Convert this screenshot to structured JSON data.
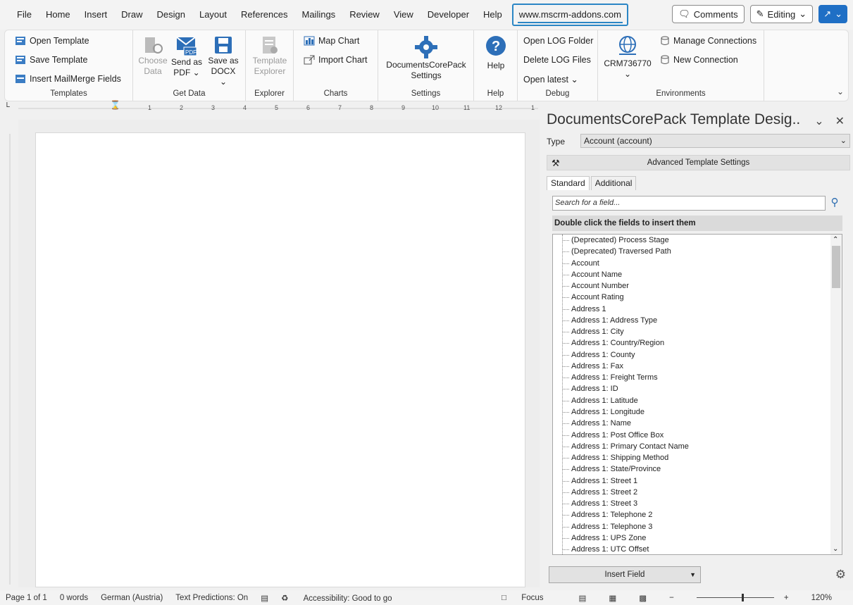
{
  "menubar": {
    "items": [
      "File",
      "Home",
      "Insert",
      "Draw",
      "Design",
      "Layout",
      "References",
      "Mailings",
      "Review",
      "View",
      "Developer",
      "Help"
    ],
    "active_tab": "www.mscrm-addons.com",
    "comments_label": "Comments",
    "editing_label": "Editing"
  },
  "ribbon": {
    "templates": {
      "open": "Open Template",
      "save": "Save Template",
      "insert_mailmerge": "Insert MailMerge Fields",
      "label": "Templates"
    },
    "get_data": {
      "choose_line1": "Choose",
      "choose_line2": "Data",
      "send_line1": "Send as",
      "send_line2": "PDF ⌄",
      "save_line1": "Save as",
      "save_line2": "DOCX ⌄",
      "label": "Get Data"
    },
    "explorer": {
      "btn_line1": "Template",
      "btn_line2": "Explorer",
      "label": "Explorer"
    },
    "charts": {
      "map_chart": "Map Chart",
      "import_chart": "Import Chart",
      "label": "Charts"
    },
    "settings": {
      "btn_line1": "DocumentsCorePack",
      "btn_line2": "Settings",
      "label": "Settings"
    },
    "help": {
      "btn": "Help",
      "label": "Help"
    },
    "debug": {
      "open_log": "Open LOG Folder",
      "delete_log": "Delete LOG Files",
      "open_latest": "Open latest ⌄",
      "label": "Debug"
    },
    "environments": {
      "crm": "CRM736770",
      "manage": "Manage Connections",
      "new_conn": "New Connection",
      "label": "Environments"
    }
  },
  "pane": {
    "title": "DocumentsCorePack Template Desig...",
    "type_label": "Type",
    "type_value": "Account (account)",
    "advanced_settings": "Advanced Template Settings",
    "tab_standard": "Standard",
    "tab_additional": "Additional",
    "search_placeholder": "Search for a field...",
    "list_header": "Double click the fields to insert them",
    "fields": [
      "(Deprecated) Process Stage",
      "(Deprecated) Traversed Path",
      "Account",
      "Account Name",
      "Account Number",
      "Account Rating",
      "Address 1",
      "Address 1: Address Type",
      "Address 1: City",
      "Address 1: Country/Region",
      "Address 1: County",
      "Address 1: Fax",
      "Address 1: Freight Terms",
      "Address 1: ID",
      "Address 1: Latitude",
      "Address 1: Longitude",
      "Address 1: Name",
      "Address 1: Post Office Box",
      "Address 1: Primary Contact Name",
      "Address 1: Shipping Method",
      "Address 1: State/Province",
      "Address 1: Street 1",
      "Address 1: Street 2",
      "Address 1: Street 3",
      "Address 1: Telephone 2",
      "Address 1: Telephone 3",
      "Address 1: UPS Zone",
      "Address 1: UTC Offset"
    ],
    "insert_field": "Insert Field"
  },
  "ruler": {
    "numbers": [
      "1",
      "2",
      "3",
      "4",
      "5",
      "6",
      "7",
      "8",
      "9",
      "10",
      "11",
      "12",
      "1"
    ]
  },
  "statusbar": {
    "page": "Page 1 of 1",
    "words": "0 words",
    "language": "German (Austria)",
    "text_predictions": "Text Predictions: On",
    "accessibility": "Accessibility: Good to go",
    "focus": "Focus",
    "zoom": "120%"
  },
  "colors": {
    "accent": "#2b86c5",
    "share": "#1f6fc5"
  }
}
